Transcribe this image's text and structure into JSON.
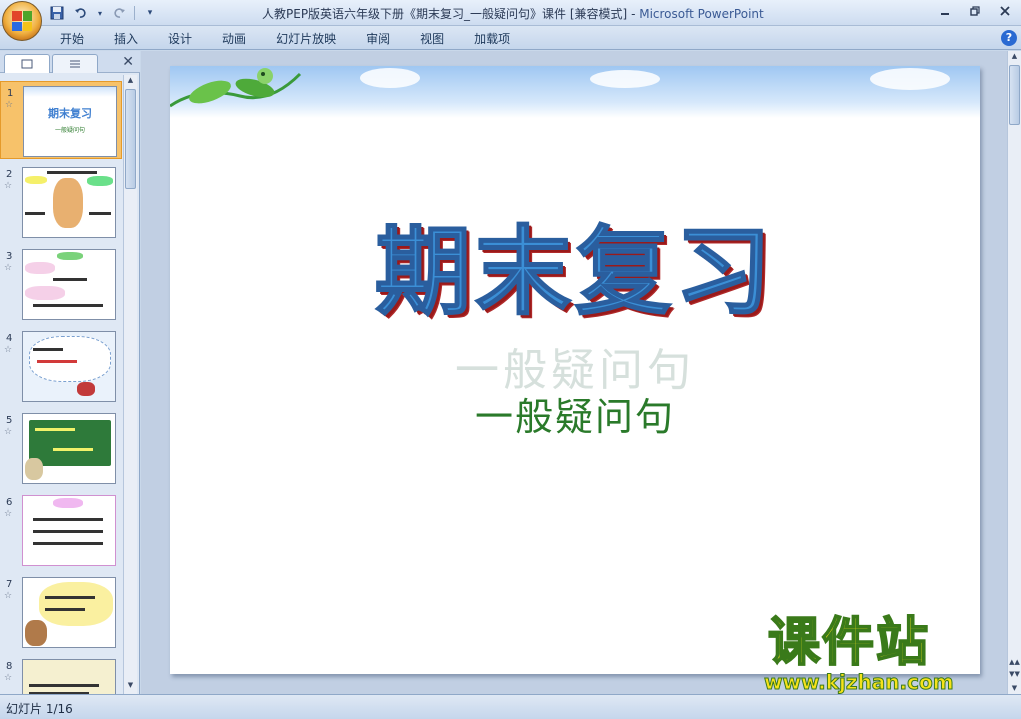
{
  "window": {
    "title": "人教PEP版英语六年级下册《期末复习_一般疑问句》课件 [兼容模式]",
    "app_name": "Microsoft PowerPoint",
    "separator": " - "
  },
  "quick_access": {
    "save_icon": "save-icon",
    "undo_icon": "undo-icon",
    "redo_icon": "redo-icon",
    "customize_icon": "dropdown-icon"
  },
  "ribbon": {
    "tabs": [
      "开始",
      "插入",
      "设计",
      "动画",
      "幻灯片放映",
      "审阅",
      "视图",
      "加载项"
    ],
    "help_label": "?"
  },
  "slides_panel": {
    "tabs": [
      "slides-tab",
      "outline-tab"
    ],
    "close_label": "✕",
    "thumbnails": [
      {
        "number": "1",
        "title": "期末复习",
        "subtitle": "一般疑问句",
        "selected": true
      },
      {
        "number": "2",
        "selected": false
      },
      {
        "number": "3",
        "selected": false
      },
      {
        "number": "4",
        "selected": false
      },
      {
        "number": "5",
        "selected": false
      },
      {
        "number": "6",
        "selected": false
      },
      {
        "number": "7",
        "selected": false
      },
      {
        "number": "8",
        "selected": false
      }
    ],
    "star_glyph": "☆"
  },
  "slide": {
    "title": "期末复习",
    "subtitle": "一般疑问句",
    "subtitle_shadow": "一般疑问句"
  },
  "status_bar": {
    "slide_indicator": "幻灯片 1/16"
  },
  "watermark": {
    "chinese": "课件站",
    "url": "www.kjzhan.com"
  },
  "colors": {
    "accent": "#3b8fd6",
    "title_shadow": "#9a1a1a",
    "subtitle": "#2a7a2a",
    "selected_thumb": "#f7c26a"
  }
}
